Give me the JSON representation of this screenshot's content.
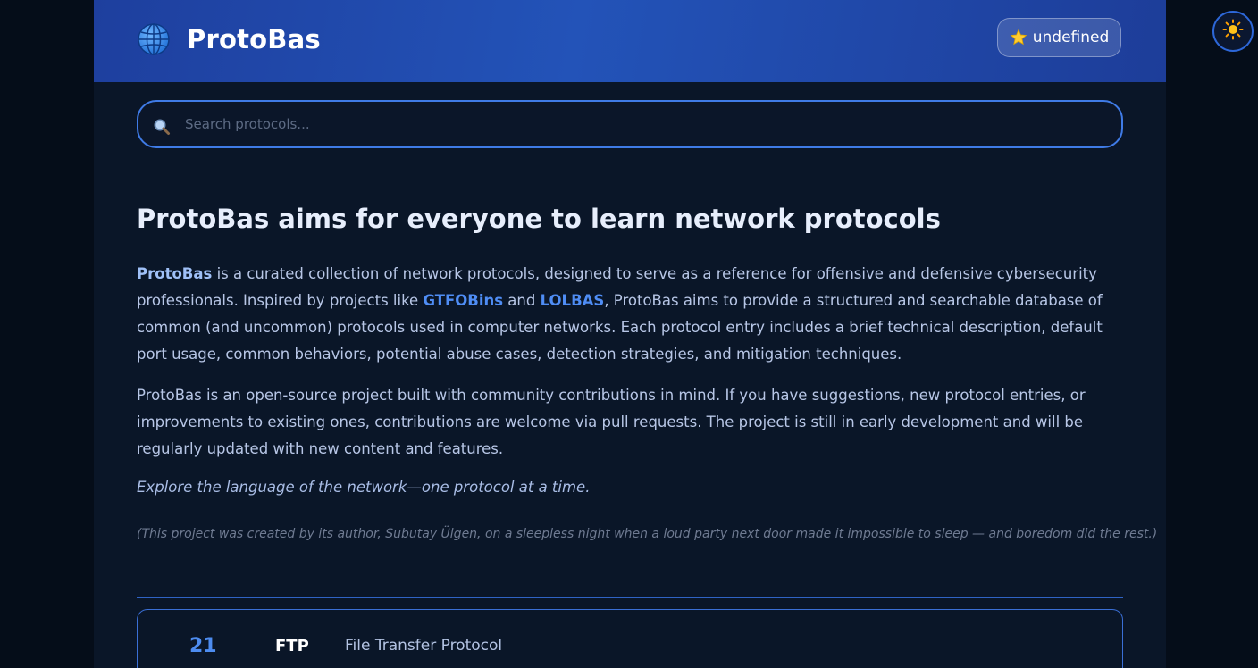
{
  "header": {
    "title": "ProtoBas",
    "globe_icon": "globe-icon",
    "star_button": {
      "icon": "star-icon",
      "label": "undefined"
    }
  },
  "theme_toggle": {
    "icon": "sun-icon"
  },
  "search": {
    "placeholder": "Search protocols...",
    "value": "",
    "icon": "search-icon"
  },
  "intro": {
    "headline": "ProtoBas aims for everyone to learn network protocols",
    "p1": {
      "brand": "ProtoBas",
      "t1": " is a curated collection of network protocols, designed to serve as a reference for offensive and defensive cybersecurity professionals. Inspired by projects like ",
      "link1": "GTFOBins",
      "t2": " and ",
      "link2": "LOLBAS",
      "t3": ", ProtoBas aims to provide a structured and searchable database of common (and uncommon) protocols used in computer networks. Each protocol entry includes a brief technical description, default port usage, common behaviors, potential abuse cases, detection strategies, and mitigation techniques."
    },
    "p2": "ProtoBas is an open-source project built with community contributions in mind. If you have suggestions, new protocol entries, or improvements to existing ones, contributions are welcome via pull requests. The project is still in early development and will be regularly updated with new content and features.",
    "tagline": "Explore the language of the network—one protocol at a time.",
    "note": "(This project was created by its author, Subutay Ülgen, on a sleepless night when a loud party next door made it impossible to sleep — and boredom did the rest.)"
  },
  "protocols": [
    {
      "port": "21",
      "abbr": "FTP",
      "name": "File Transfer Protocol"
    }
  ],
  "colors": {
    "accent": "#3f7be6",
    "link": "#4f8df5",
    "header_start": "#1e3f9e",
    "background": "#0a1628"
  }
}
